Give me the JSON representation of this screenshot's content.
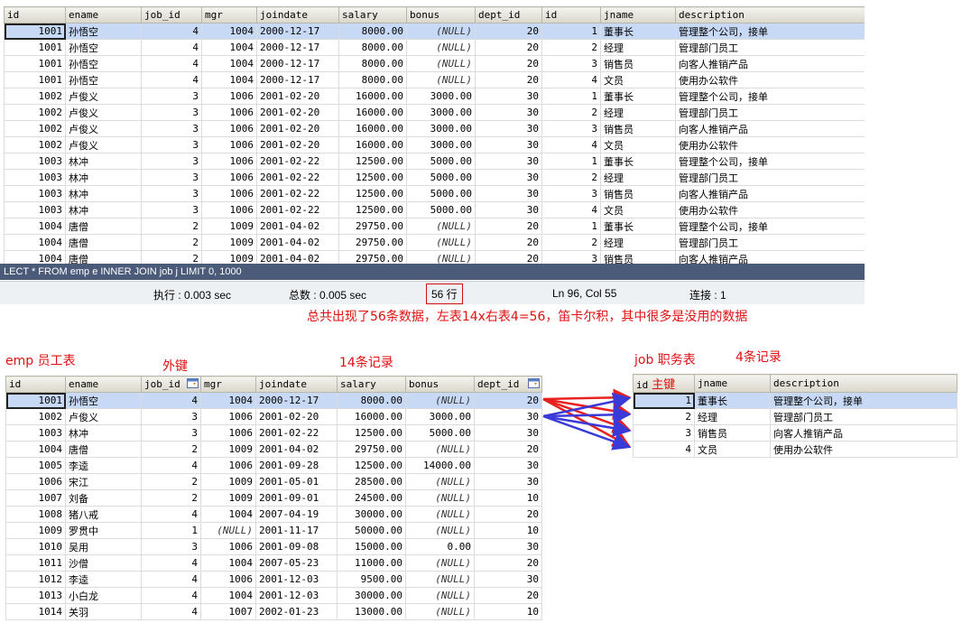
{
  "top_grid": {
    "columns": [
      "id",
      "ename",
      "job_id",
      "mgr",
      "joindate",
      "salary",
      "bonus",
      "dept_id",
      "id",
      "jname",
      "description"
    ],
    "rows": [
      [
        "1001",
        "孙悟空",
        "4",
        "1004",
        "2000-12-17",
        "8000.00",
        "(NULL)",
        "20",
        "1",
        "董事长",
        "管理整个公司，接单"
      ],
      [
        "1001",
        "孙悟空",
        "4",
        "1004",
        "2000-12-17",
        "8000.00",
        "(NULL)",
        "20",
        "2",
        "经理",
        "管理部门员工"
      ],
      [
        "1001",
        "孙悟空",
        "4",
        "1004",
        "2000-12-17",
        "8000.00",
        "(NULL)",
        "20",
        "3",
        "销售员",
        "向客人推销产品"
      ],
      [
        "1001",
        "孙悟空",
        "4",
        "1004",
        "2000-12-17",
        "8000.00",
        "(NULL)",
        "20",
        "4",
        "文员",
        "使用办公软件"
      ],
      [
        "1002",
        "卢俊义",
        "3",
        "1006",
        "2001-02-20",
        "16000.00",
        "3000.00",
        "30",
        "1",
        "董事长",
        "管理整个公司，接单"
      ],
      [
        "1002",
        "卢俊义",
        "3",
        "1006",
        "2001-02-20",
        "16000.00",
        "3000.00",
        "30",
        "2",
        "经理",
        "管理部门员工"
      ],
      [
        "1002",
        "卢俊义",
        "3",
        "1006",
        "2001-02-20",
        "16000.00",
        "3000.00",
        "30",
        "3",
        "销售员",
        "向客人推销产品"
      ],
      [
        "1002",
        "卢俊义",
        "3",
        "1006",
        "2001-02-20",
        "16000.00",
        "3000.00",
        "30",
        "4",
        "文员",
        "使用办公软件"
      ],
      [
        "1003",
        "林冲",
        "3",
        "1006",
        "2001-02-22",
        "12500.00",
        "5000.00",
        "30",
        "1",
        "董事长",
        "管理整个公司，接单"
      ],
      [
        "1003",
        "林冲",
        "3",
        "1006",
        "2001-02-22",
        "12500.00",
        "5000.00",
        "30",
        "2",
        "经理",
        "管理部门员工"
      ],
      [
        "1003",
        "林冲",
        "3",
        "1006",
        "2001-02-22",
        "12500.00",
        "5000.00",
        "30",
        "3",
        "销售员",
        "向客人推销产品"
      ],
      [
        "1003",
        "林冲",
        "3",
        "1006",
        "2001-02-22",
        "12500.00",
        "5000.00",
        "30",
        "4",
        "文员",
        "使用办公软件"
      ],
      [
        "1004",
        "唐僧",
        "2",
        "1009",
        "2001-04-02",
        "29750.00",
        "(NULL)",
        "20",
        "1",
        "董事长",
        "管理整个公司，接单"
      ],
      [
        "1004",
        "唐僧",
        "2",
        "1009",
        "2001-04-02",
        "29750.00",
        "(NULL)",
        "20",
        "2",
        "经理",
        "管理部门员工"
      ],
      [
        "1004",
        "唐僧",
        "2",
        "1009",
        "2001-04-02",
        "29750.00",
        "(NULL)",
        "20",
        "3",
        "销售员",
        "向客人推销产品"
      ]
    ]
  },
  "query_text": "LECT * FROM emp e INNER JOIN job j LIMIT 0, 1000",
  "status": {
    "exec": "执行 : 0.003 sec",
    "total": "总数 : 0.005 sec",
    "rows": "56 行",
    "position": "Ln 96, Col 55",
    "connection": "连接 : 1"
  },
  "notes": {
    "summary": "总共出现了56条数据，左表14x右表4=56，笛卡尔积，其中很多是没用的数据",
    "emp_title": "emp 员工表",
    "foreign_key": "外键",
    "emp_count": "14条记录",
    "job_title": "job 职务表",
    "job_count": "4条记录",
    "primary_key": "主键"
  },
  "emp_grid": {
    "columns": [
      "id",
      "ename",
      "job_id",
      "mgr",
      "joindate",
      "salary",
      "bonus",
      "dept_id"
    ],
    "rows": [
      [
        "1001",
        "孙悟空",
        "4",
        "1004",
        "2000-12-17",
        "8000.00",
        "(NULL)",
        "20"
      ],
      [
        "1002",
        "卢俊义",
        "3",
        "1006",
        "2001-02-20",
        "16000.00",
        "3000.00",
        "30"
      ],
      [
        "1003",
        "林冲",
        "3",
        "1006",
        "2001-02-22",
        "12500.00",
        "5000.00",
        "30"
      ],
      [
        "1004",
        "唐僧",
        "2",
        "1009",
        "2001-04-02",
        "29750.00",
        "(NULL)",
        "20"
      ],
      [
        "1005",
        "李逵",
        "4",
        "1006",
        "2001-09-28",
        "12500.00",
        "14000.00",
        "30"
      ],
      [
        "1006",
        "宋江",
        "2",
        "1009",
        "2001-05-01",
        "28500.00",
        "(NULL)",
        "30"
      ],
      [
        "1007",
        "刘备",
        "2",
        "1009",
        "2001-09-01",
        "24500.00",
        "(NULL)",
        "10"
      ],
      [
        "1008",
        "猪八戒",
        "4",
        "1004",
        "2007-04-19",
        "30000.00",
        "(NULL)",
        "20"
      ],
      [
        "1009",
        "罗贯中",
        "1",
        "(NULL)",
        "2001-11-17",
        "50000.00",
        "(NULL)",
        "10"
      ],
      [
        "1010",
        "吴用",
        "3",
        "1006",
        "2001-09-08",
        "15000.00",
        "0.00",
        "30"
      ],
      [
        "1011",
        "沙僧",
        "4",
        "1004",
        "2007-05-23",
        "11000.00",
        "(NULL)",
        "20"
      ],
      [
        "1012",
        "李逵",
        "4",
        "1006",
        "2001-12-03",
        "9500.00",
        "(NULL)",
        "30"
      ],
      [
        "1013",
        "小白龙",
        "4",
        "1004",
        "2001-12-03",
        "30000.00",
        "(NULL)",
        "20"
      ],
      [
        "1014",
        "关羽",
        "4",
        "1007",
        "2002-01-23",
        "13000.00",
        "(NULL)",
        "10"
      ]
    ]
  },
  "job_grid": {
    "columns": [
      "id",
      "jname",
      "description"
    ],
    "rows": [
      [
        "1",
        "董事长",
        "管理整个公司，接单"
      ],
      [
        "2",
        "经理",
        "管理部门员工"
      ],
      [
        "3",
        "销售员",
        "向客人推销产品"
      ],
      [
        "4",
        "文员",
        "使用办公软件"
      ]
    ]
  },
  "colors": {
    "note_red": "#e01010",
    "arrow_red": "#e82020",
    "arrow_blue": "#3a3ad8",
    "select_blue": "#c7d9f5",
    "query_bar": "#4b5a78"
  }
}
